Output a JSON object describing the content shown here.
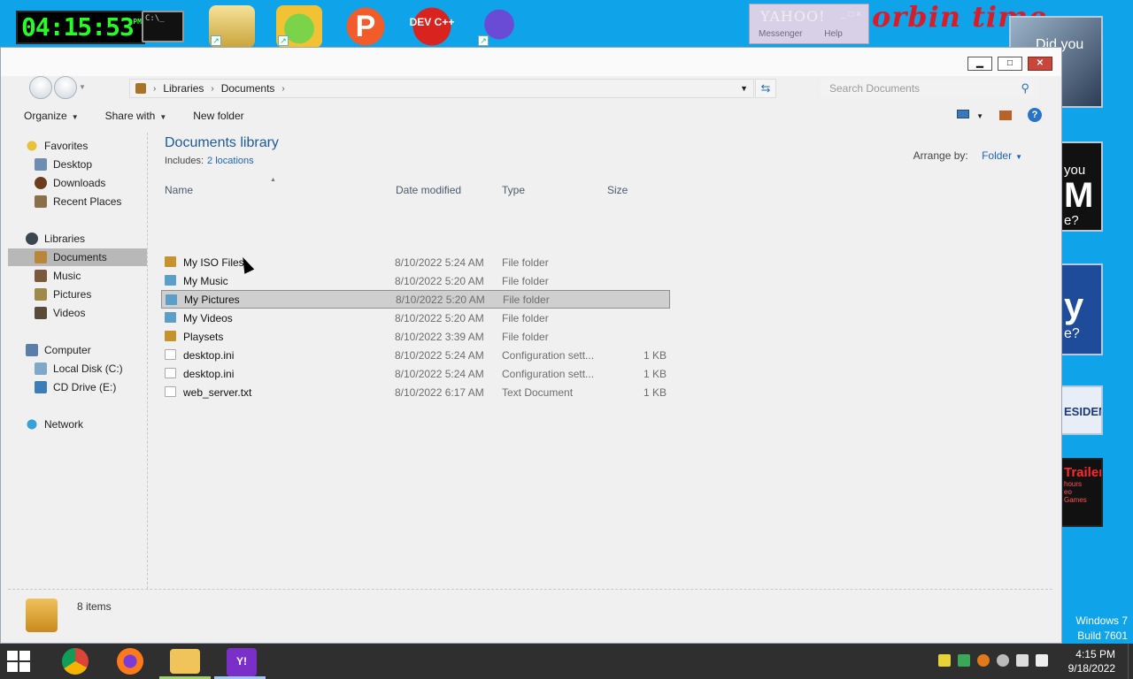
{
  "desktop": {
    "clock_widget": {
      "time": "04:15:53",
      "ampm": "PM"
    },
    "cmd_text": "C:\\_",
    "dev_icon_label": "DEV C++",
    "p_icon_label": "P",
    "yahoo_messenger": {
      "title": "YAHOO!",
      "menu": [
        "Messenger",
        "Help"
      ],
      "buttons": "_ □ ×"
    },
    "banner_text": "orbin  time",
    "ads": {
      "ad1": "Did you",
      "ad2_line1": "you",
      "ad2_big": "M",
      "ad2_line3": "e?",
      "ad3": "y",
      "ad3_sub": "e?",
      "ad4": "ESIDENT",
      "ad5": "Trailer",
      "ad5_sub1": "hours",
      "ad5_sub2": "eo",
      "ad5_sub3": "Games"
    },
    "os_label": "Windows 7",
    "build_label": "Build 7601"
  },
  "window": {
    "buttons": {
      "minimize": "▁",
      "maximize": "□",
      "close": "✕"
    }
  },
  "navigation": {
    "breadcrumb": [
      "Libraries",
      "Documents"
    ],
    "search_placeholder": "Search Documents"
  },
  "toolbar": {
    "organize": "Organize",
    "share_with": "Share with",
    "new_folder": "New folder",
    "help": "?"
  },
  "sidebar": {
    "favorites": "Favorites",
    "favorites_items": [
      "Desktop",
      "Downloads",
      "Recent Places"
    ],
    "libraries": "Libraries",
    "libraries_items": [
      "Documents",
      "Music",
      "Pictures",
      "Videos"
    ],
    "computer": "Computer",
    "computer_items": [
      "Local Disk (C:)",
      "CD Drive (E:)"
    ],
    "network": "Network",
    "selected": "Documents"
  },
  "content": {
    "title": "Documents library",
    "includes_label": "Includes:",
    "includes_link": "2 locations",
    "arrange_label": "Arrange by:",
    "arrange_value": "Folder",
    "columns": {
      "name": "Name",
      "date": "Date modified",
      "type": "Type",
      "size": "Size"
    },
    "files": [
      {
        "name": "My ISO Files",
        "date": "8/10/2022 5:24 AM",
        "type": "File folder",
        "size": "",
        "icon": "folder-icon"
      },
      {
        "name": "My Music",
        "date": "8/10/2022 5:20 AM",
        "type": "File folder",
        "size": "",
        "icon": "music-folder-icon"
      },
      {
        "name": "My Pictures",
        "date": "8/10/2022 5:20 AM",
        "type": "File folder",
        "size": "",
        "icon": "pictures-folder-icon"
      },
      {
        "name": "My Videos",
        "date": "8/10/2022 5:20 AM",
        "type": "File folder",
        "size": "",
        "icon": "videos-folder-icon"
      },
      {
        "name": "Playsets",
        "date": "8/10/2022 3:39 AM",
        "type": "File folder",
        "size": "",
        "icon": "folder-icon"
      },
      {
        "name": "desktop.ini",
        "date": "8/10/2022 5:24 AM",
        "type": "Configuration sett...",
        "size": "1 KB",
        "icon": "config-file-icon"
      },
      {
        "name": "desktop.ini",
        "date": "8/10/2022 5:24 AM",
        "type": "Configuration sett...",
        "size": "1 KB",
        "icon": "config-file-icon"
      },
      {
        "name": "web_server.txt",
        "date": "8/10/2022 6:17 AM",
        "type": "Text Document",
        "size": "1 KB",
        "icon": "text-file-icon"
      }
    ],
    "selected_file": "My Pictures"
  },
  "status": {
    "item_count": "8 items"
  },
  "taskbar": {
    "apps": [
      "Chrome",
      "Firefox",
      "Windows Explorer",
      "Yahoo Messenger"
    ],
    "time": "4:15 PM",
    "date": "9/18/2022"
  }
}
